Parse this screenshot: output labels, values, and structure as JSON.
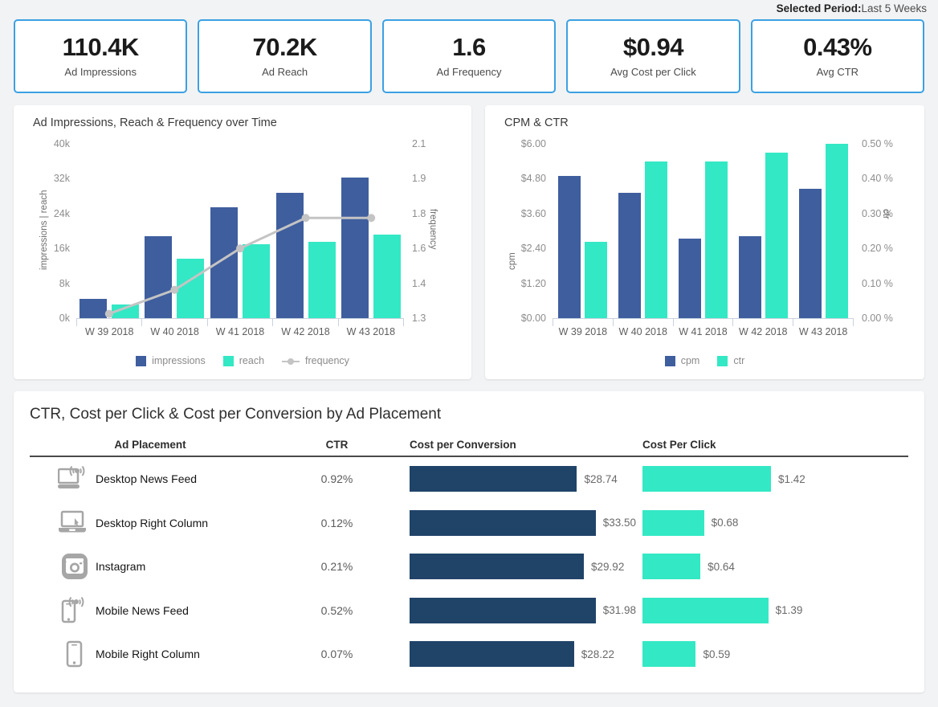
{
  "header": {
    "period_label": "Selected Period:",
    "period_value": "Last 5 Weeks"
  },
  "kpis": [
    {
      "value": "110.4K",
      "label": "Ad Impressions"
    },
    {
      "value": "70.2K",
      "label": "Ad Reach"
    },
    {
      "value": "1.6",
      "label": "Ad Frequency"
    },
    {
      "value": "$0.94",
      "label": "Avg Cost per Click"
    },
    {
      "value": "0.43%",
      "label": "Avg CTR"
    }
  ],
  "colors": {
    "accent_blue": "#3ba1e3",
    "series_blue": "#3f5e9e",
    "series_green": "#33e8c4",
    "series_line": "#c4c4c4",
    "bar_navy": "#204368",
    "bar_mint": "#33e8c4",
    "page_bg": "#f2f3f5"
  },
  "chart_data": [
    {
      "type": "bar",
      "id": "impressions-reach-frequency",
      "title": "Ad Impressions, Reach & Frequency over Time",
      "categories": [
        "W 39 2018",
        "W 40 2018",
        "W 41 2018",
        "W 42 2018",
        "W 43 2018"
      ],
      "xlabel": "",
      "ylabel": "impressions | reach",
      "y2label": "frequency",
      "ylim": [
        0,
        40000
      ],
      "y2lim": [
        1.3,
        2.1
      ],
      "yticks": [
        "0k",
        "8k",
        "16k",
        "24k",
        "32k",
        "40k"
      ],
      "ytick_values": [
        0,
        8000,
        16000,
        24000,
        32000,
        40000
      ],
      "y2ticks": [
        "1.3",
        "1.4",
        "1.6",
        "1.8",
        "1.9",
        "2.1"
      ],
      "y2tick_values": [
        1.3,
        1.4,
        1.6,
        1.8,
        1.9,
        2.1
      ],
      "grid": false,
      "legend_position": "bottom",
      "series": [
        {
          "name": "impressions",
          "type": "bar",
          "color": "#3f5e9e",
          "values": [
            4400,
            18800,
            25400,
            28800,
            32300
          ]
        },
        {
          "name": "reach",
          "type": "bar",
          "color": "#33e8c4",
          "values": [
            3100,
            13600,
            17000,
            17500,
            19100
          ]
        },
        {
          "name": "frequency",
          "type": "line",
          "color": "#c4c4c4",
          "axis": "y2",
          "values": [
            1.32,
            1.43,
            1.62,
            1.76,
            1.76
          ]
        }
      ]
    },
    {
      "type": "bar",
      "id": "cpm-ctr",
      "title": "CPM & CTR",
      "categories": [
        "W 39 2018",
        "W 40 2018",
        "W 41 2018",
        "W 42 2018",
        "W 43 2018"
      ],
      "xlabel": "",
      "ylabel": "cpm",
      "y2label": "ctr",
      "ylim": [
        0,
        6.0
      ],
      "y2lim": [
        0,
        0.5
      ],
      "yticks": [
        "$0.00",
        "$1.20",
        "$2.40",
        "$3.60",
        "$4.80",
        "$6.00"
      ],
      "ytick_values": [
        0,
        1.2,
        2.4,
        3.6,
        4.8,
        6.0
      ],
      "y2ticks": [
        "0.00 %",
        "0.10 %",
        "0.20 %",
        "0.30 %",
        "0.40 %",
        "0.50 %"
      ],
      "y2tick_values": [
        0,
        0.1,
        0.2,
        0.3,
        0.4,
        0.5
      ],
      "grid": false,
      "legend_position": "bottom",
      "series": [
        {
          "name": "cpm",
          "type": "bar",
          "color": "#3f5e9e",
          "values": [
            4.9,
            4.3,
            2.75,
            2.82,
            4.45
          ]
        },
        {
          "name": "ctr",
          "type": "bar",
          "color": "#33e8c4",
          "axis": "y2",
          "values": [
            0.22,
            0.45,
            0.45,
            0.475,
            0.5
          ]
        }
      ]
    }
  ],
  "table": {
    "title": "CTR, Cost per Click & Cost per Conversion by Ad Placement",
    "columns": [
      "Ad Placement",
      "CTR",
      "Cost per Conversion",
      "Cost Per Click"
    ],
    "cpc_max": 33.5,
    "cpclick_max": 1.42,
    "rows": [
      {
        "icon": "desktop-news-feed-icon",
        "placement": "Desktop News Feed",
        "ctr": "0.92%",
        "cost_per_conversion": "$28.74",
        "cost_per_conversion_value": 28.74,
        "cost_per_click": "$1.42",
        "cost_per_click_value": 1.42
      },
      {
        "icon": "desktop-right-column-icon",
        "placement": "Desktop Right Column",
        "ctr": "0.12%",
        "cost_per_conversion": "$33.50",
        "cost_per_conversion_value": 33.5,
        "cost_per_click": "$0.68",
        "cost_per_click_value": 0.68
      },
      {
        "icon": "instagram-icon",
        "placement": "Instagram",
        "ctr": "0.21%",
        "cost_per_conversion": "$29.92",
        "cost_per_conversion_value": 29.92,
        "cost_per_click": "$0.64",
        "cost_per_click_value": 0.64
      },
      {
        "icon": "mobile-news-feed-icon",
        "placement": "Mobile News Feed",
        "ctr": "0.52%",
        "cost_per_conversion": "$31.98",
        "cost_per_conversion_value": 31.98,
        "cost_per_click": "$1.39",
        "cost_per_click_value": 1.39
      },
      {
        "icon": "mobile-right-column-icon",
        "placement": "Mobile Right Column",
        "ctr": "0.07%",
        "cost_per_conversion": "$28.22",
        "cost_per_conversion_value": 28.22,
        "cost_per_click": "$0.59",
        "cost_per_click_value": 0.59
      }
    ]
  }
}
